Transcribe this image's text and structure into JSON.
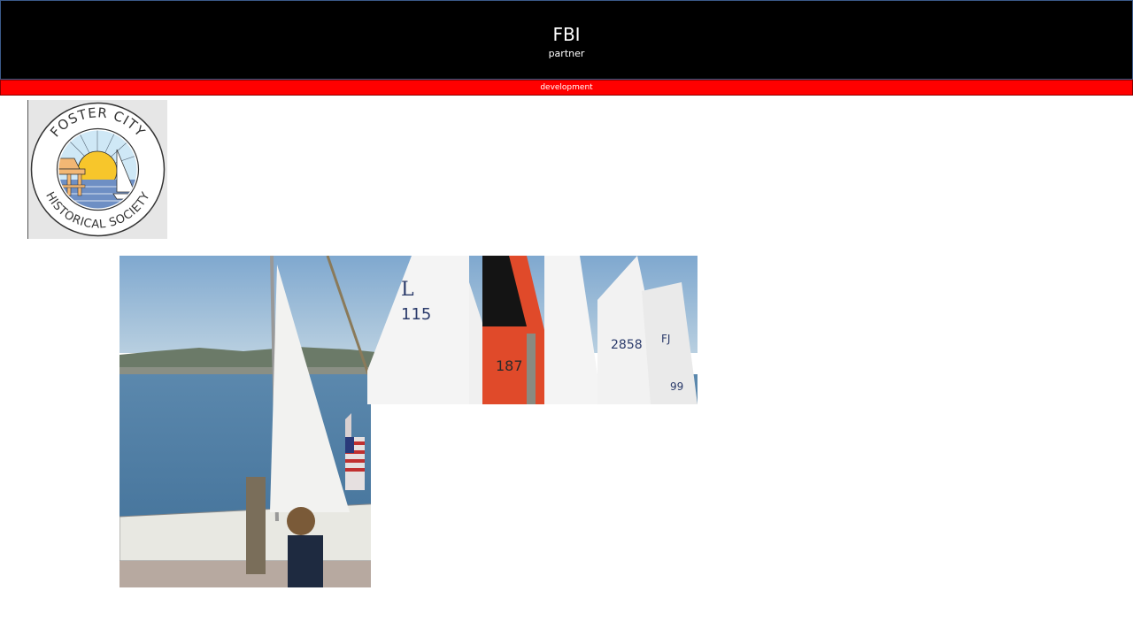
{
  "header": {
    "title": "FBI",
    "subtitle": "partner"
  },
  "banner": {
    "label": "development"
  },
  "logo": {
    "top_text": "FOSTER CITY",
    "bottom_text": "HISTORICAL SOCIETY",
    "colors": {
      "sky": "#cfe8f6",
      "sun": "#f7c62b",
      "water": "#6e8fc4",
      "building": "#f2b774"
    }
  },
  "photo": {
    "sail_numbers": [
      "L",
      "115",
      "187",
      "2858",
      "FJ",
      "99"
    ]
  }
}
